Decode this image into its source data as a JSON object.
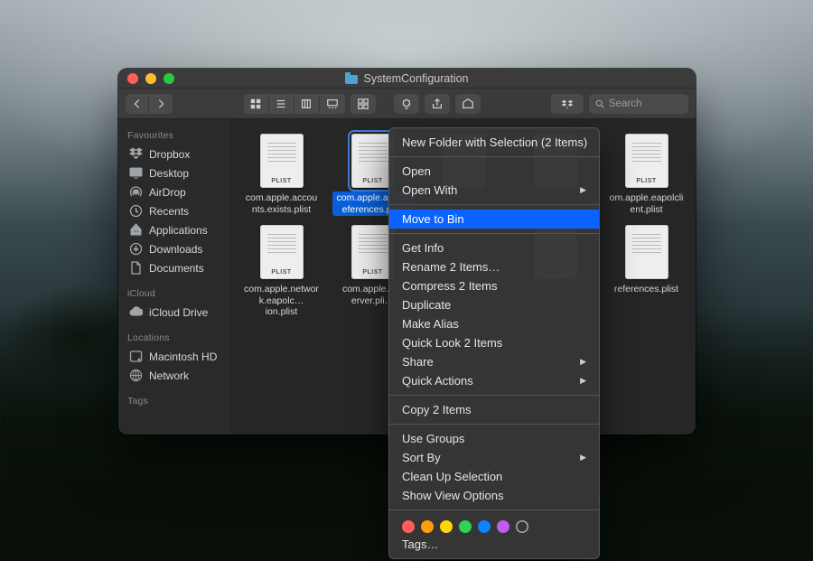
{
  "window": {
    "title": "SystemConfiguration"
  },
  "toolbar": {
    "search_placeholder": "Search"
  },
  "sidebar": {
    "sections": [
      {
        "heading": "Favourites",
        "items": [
          {
            "icon": "dropbox",
            "label": "Dropbox",
            "name": "sidebar-item-dropbox"
          },
          {
            "icon": "desktop",
            "label": "Desktop",
            "name": "sidebar-item-desktop"
          },
          {
            "icon": "airdrop",
            "label": "AirDrop",
            "name": "sidebar-item-airdrop"
          },
          {
            "icon": "recents",
            "label": "Recents",
            "name": "sidebar-item-recents"
          },
          {
            "icon": "apps",
            "label": "Applications",
            "name": "sidebar-item-applications"
          },
          {
            "icon": "downloads",
            "label": "Downloads",
            "name": "sidebar-item-downloads"
          },
          {
            "icon": "documents",
            "label": "Documents",
            "name": "sidebar-item-documents"
          }
        ]
      },
      {
        "heading": "iCloud",
        "items": [
          {
            "icon": "cloud",
            "label": "iCloud Drive",
            "name": "sidebar-item-icloud-drive"
          }
        ]
      },
      {
        "heading": "Locations",
        "items": [
          {
            "icon": "disk",
            "label": "Macintosh HD",
            "name": "sidebar-item-macintosh-hd"
          },
          {
            "icon": "network",
            "label": "Network",
            "name": "sidebar-item-network"
          }
        ]
      },
      {
        "heading": "Tags",
        "items": []
      }
    ]
  },
  "files": [
    {
      "label": "com.apple.accounts.exists.plist",
      "selected": false,
      "ext": "PLIST"
    },
    {
      "label": "com.apple.a….preferences.plist",
      "selected": true,
      "ext": "PLIST"
    },
    {
      "label": "",
      "selected": false,
      "ext": "PLIST",
      "partial": true
    },
    {
      "label": "",
      "selected": false,
      "ext": "PLIST",
      "partial": true
    },
    {
      "label": "om.apple.eapolclient.plist",
      "selected": false,
      "ext": "PLIST"
    },
    {
      "label": "com.apple.network.eapolc…ion.plist",
      "selected": false,
      "ext": "PLIST"
    },
    {
      "label": "com.apple.s…erver.pli…",
      "selected": false,
      "ext": "PLIST"
    },
    {
      "label": "",
      "selected": false,
      "ext": "",
      "partial": true
    },
    {
      "label": "",
      "selected": false,
      "ext": "PLIST",
      "partial": true
    },
    {
      "label": "references.plist",
      "selected": false,
      "ext": ""
    }
  ],
  "context_menu": {
    "groups": [
      [
        {
          "label": "New Folder with Selection (2 Items)",
          "submenu": false
        }
      ],
      [
        {
          "label": "Open",
          "submenu": false
        },
        {
          "label": "Open With",
          "submenu": true
        }
      ],
      [
        {
          "label": "Move to Bin",
          "submenu": false,
          "highlight": true
        }
      ],
      [
        {
          "label": "Get Info",
          "submenu": false
        },
        {
          "label": "Rename 2 Items…",
          "submenu": false
        },
        {
          "label": "Compress 2 Items",
          "submenu": false
        },
        {
          "label": "Duplicate",
          "submenu": false
        },
        {
          "label": "Make Alias",
          "submenu": false
        },
        {
          "label": "Quick Look 2 Items",
          "submenu": false
        },
        {
          "label": "Share",
          "submenu": true
        },
        {
          "label": "Quick Actions",
          "submenu": true
        }
      ],
      [
        {
          "label": "Copy 2 Items",
          "submenu": false
        }
      ],
      [
        {
          "label": "Use Groups",
          "submenu": false
        },
        {
          "label": "Sort By",
          "submenu": true
        },
        {
          "label": "Clean Up Selection",
          "submenu": false
        },
        {
          "label": "Show View Options",
          "submenu": false
        }
      ]
    ],
    "tags_label": "Tags…",
    "tag_colors": [
      "#ff5f57",
      "#ff9f0a",
      "#ffd60a",
      "#30d158",
      "#0a84ff",
      "#bf5af2",
      "#8e8e93"
    ]
  }
}
